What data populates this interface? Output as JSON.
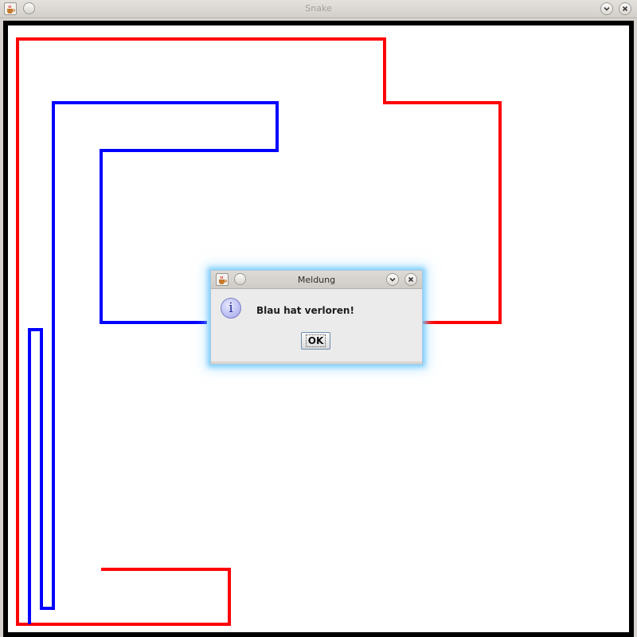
{
  "window": {
    "title": "Snake",
    "app_icon": "java-cup-icon",
    "buttons": [
      "minimize-icon",
      "close-icon"
    ]
  },
  "game": {
    "background": "#ffffff",
    "border_color": "#000000",
    "players": [
      {
        "color": "#ff0000",
        "icon": "red-snake-trail"
      },
      {
        "color": "#0000ff",
        "icon": "blue-snake-trail"
      }
    ]
  },
  "dialog": {
    "title": "Meldung",
    "message": "Blau hat verloren!",
    "ok_label": "OK",
    "icon": "info-icon"
  }
}
